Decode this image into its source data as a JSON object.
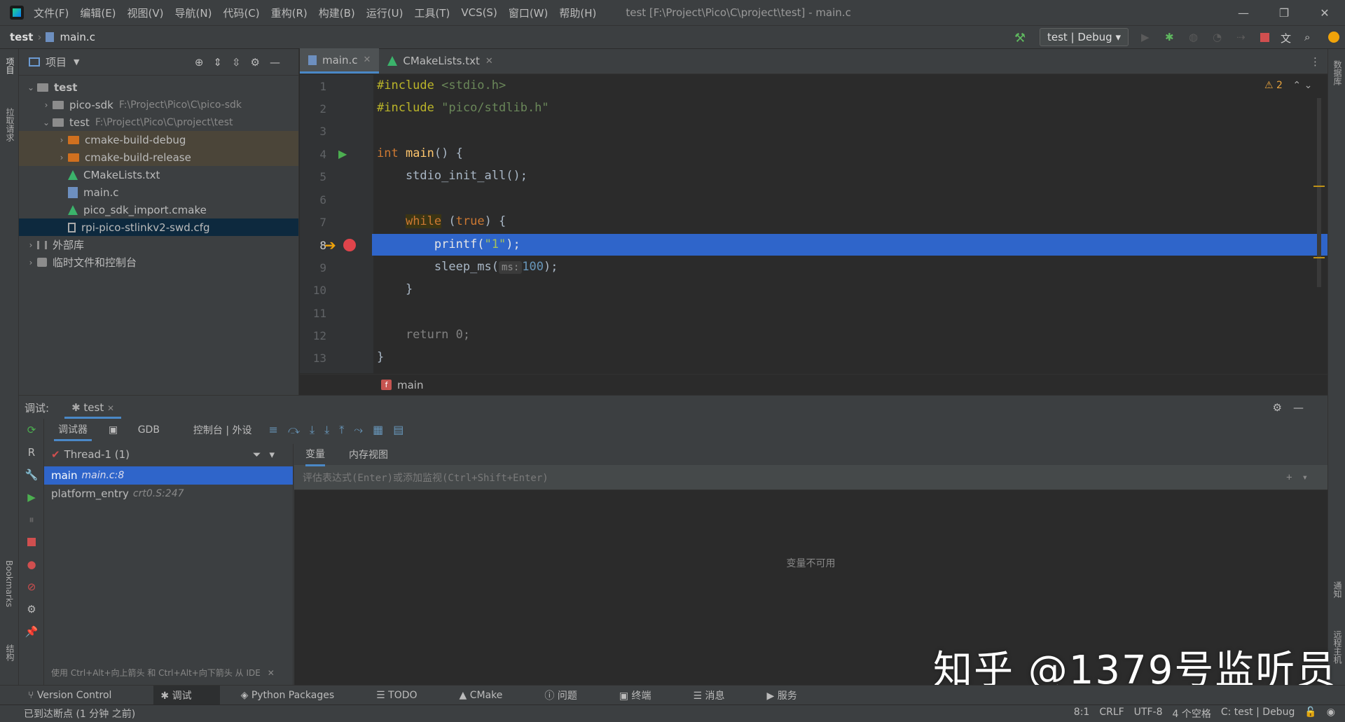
{
  "titlebar": {
    "menus": [
      "文件(F)",
      "编辑(E)",
      "视图(V)",
      "导航(N)",
      "代码(C)",
      "重构(R)",
      "构建(B)",
      "运行(U)",
      "工具(T)",
      "VCS(S)",
      "窗口(W)",
      "帮助(H)"
    ],
    "title": "test [F:\\Project\\Pico\\C\\project\\test] - main.c"
  },
  "navbar": {
    "project": "test",
    "file": "main.c",
    "run_config": "test | Debug"
  },
  "left_strip": {
    "project": "项目",
    "pull": "拉取请求",
    "bookmarks": "Bookmarks",
    "structure": "结构"
  },
  "right_strip": {
    "database": "数据库",
    "notifications": "通知",
    "remote": "远程主机"
  },
  "project_panel": {
    "title": "项目",
    "tree": [
      {
        "label": "test",
        "path": "",
        "depth": 0,
        "expanded": true,
        "kind": "root"
      },
      {
        "label": "pico-sdk",
        "path": "F:\\Project\\Pico\\C\\pico-sdk",
        "depth": 1,
        "expanded": false,
        "kind": "folder"
      },
      {
        "label": "test",
        "path": "F:\\Project\\Pico\\C\\project\\test",
        "depth": 1,
        "expanded": true,
        "kind": "folder"
      },
      {
        "label": "cmake-build-debug",
        "path": "",
        "depth": 2,
        "expanded": false,
        "kind": "orange"
      },
      {
        "label": "cmake-build-release",
        "path": "",
        "depth": 2,
        "expanded": false,
        "kind": "orange"
      },
      {
        "label": "CMakeLists.txt",
        "path": "",
        "depth": 2,
        "kind": "cmake"
      },
      {
        "label": "main.c",
        "path": "",
        "depth": 2,
        "kind": "c"
      },
      {
        "label": "pico_sdk_import.cmake",
        "path": "",
        "depth": 2,
        "kind": "cmake"
      },
      {
        "label": "rpi-pico-stlinkv2-swd.cfg",
        "path": "",
        "depth": 2,
        "kind": "cfg",
        "selected": true
      },
      {
        "label": "外部库",
        "path": "",
        "depth": 0,
        "expanded": false,
        "kind": "lib"
      },
      {
        "label": "临时文件和控制台",
        "path": "",
        "depth": 0,
        "expanded": false,
        "kind": "scratch"
      }
    ]
  },
  "editor": {
    "tabs": [
      {
        "label": "main.c",
        "active": true
      },
      {
        "label": "CMakeLists.txt",
        "active": false
      }
    ],
    "warnings": "2",
    "line_numbers": [
      "1",
      "2",
      "3",
      "4",
      "5",
      "6",
      "7",
      "8",
      "9",
      "10",
      "11",
      "12",
      "13"
    ],
    "code": {
      "l1_kw": "#include",
      "l1_rest": " <stdio.h>",
      "l2_kw": "#include",
      "l2_rest": " \"pico/stdlib.h\"",
      "l4_kw": "int",
      "l4_fn": " main",
      "l4_rest": "() {",
      "l5": "    stdio_init_all();",
      "l7_kw": "while",
      "l7_a": " (",
      "l7_true": "true",
      "l7_b": ") {",
      "l8_fn": "        printf(",
      "l8_str": "\"1\"",
      "l8_end": ");",
      "l9_fn": "        sleep_ms(",
      "l9_hint": "ms:",
      "l9_num": "100",
      "l9_end": ");",
      "l10": "    }",
      "l12": "    return 0;",
      "l13": "}"
    },
    "breadcrumb": "main"
  },
  "debug": {
    "label": "调试:",
    "session": "test",
    "tabs": [
      "调试器",
      "GDB",
      "控制台 | 外设"
    ],
    "thread": "Thread-1 (1)",
    "frames": [
      {
        "name": "main",
        "loc": "main.c:8",
        "selected": true
      },
      {
        "name": "platform_entry",
        "loc": "crt0.S:247",
        "selected": false
      }
    ],
    "frame_hint": "使用 Ctrl+Alt+向上箭头 和 Ctrl+Alt+向下箭头 从 IDE",
    "var_tabs": [
      "变量",
      "内存视图"
    ],
    "eval_placeholder": "评估表达式(Enter)或添加监视(Ctrl+Shift+Enter)",
    "no_vars": "变量不可用"
  },
  "toolwindows": [
    "Version Control",
    "调试",
    "Python Packages",
    "TODO",
    "CMake",
    "问题",
    "终端",
    "消息",
    "服务"
  ],
  "status": {
    "message": "已到达断点 (1 分钟 之前)",
    "position": "8:1",
    "line_sep": "CRLF",
    "encoding": "UTF-8",
    "indent": "4 个空格",
    "context": "C: test | Debug"
  },
  "watermark": "知乎 @1379号监听员",
  "colors": {
    "selection": "#2f65ca",
    "tab_underline": "#4a88c7",
    "orange_folder": "#d0701f",
    "breakpoint": "#e0444b"
  }
}
